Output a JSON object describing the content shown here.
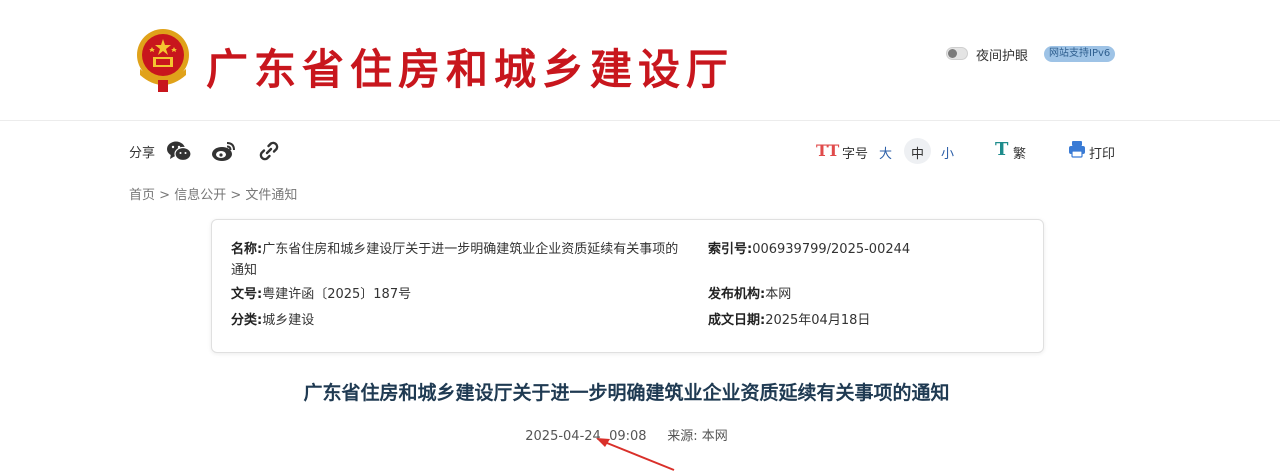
{
  "header": {
    "site_title": "广东省住房和城乡建设厅",
    "night_mode_label": "夜间护眼",
    "ipv6_badge": "网站支持IPv6"
  },
  "toolbar": {
    "share_label": "分享",
    "share_icons": [
      "wechat-icon",
      "weibo-icon",
      "link-icon"
    ],
    "fontsize_icon": "TT",
    "fontsize_label": "字号",
    "size_large": "大",
    "size_medium": "中",
    "size_small": "小",
    "traditional_icon": "T",
    "traditional_label": "繁",
    "print_label": "打印"
  },
  "breadcrumb": {
    "home": "首页",
    "sep": ">",
    "info": "信息公开",
    "notice": "文件通知"
  },
  "info": {
    "name_label": "名称:",
    "name_value": "广东省住房和城乡建设厅关于进一步明确建筑业企业资质延续有关事项的通知",
    "doc_no_label": "文号:",
    "doc_no_value": "粤建许函〔2025〕187号",
    "category_label": "分类:",
    "category_value": "城乡建设",
    "index_label": "索引号:",
    "index_value": "006939799/2025-00244",
    "publisher_label": "发布机构:",
    "publisher_value": "本网",
    "date_label": "成文日期:",
    "date_value": "2025年04月18日"
  },
  "article": {
    "title": "广东省住房和城乡建设厅关于进一步明确建筑业企业资质延续有关事项的通知",
    "datetime": "2025-04-24  09:08",
    "source_label": "来源:",
    "source_value": "本网"
  },
  "colors": {
    "title_red": "#c8161d",
    "link_blue": "#2c5fa8",
    "article_title": "#1f3a52",
    "annotation_arrow": "#d9302a"
  }
}
